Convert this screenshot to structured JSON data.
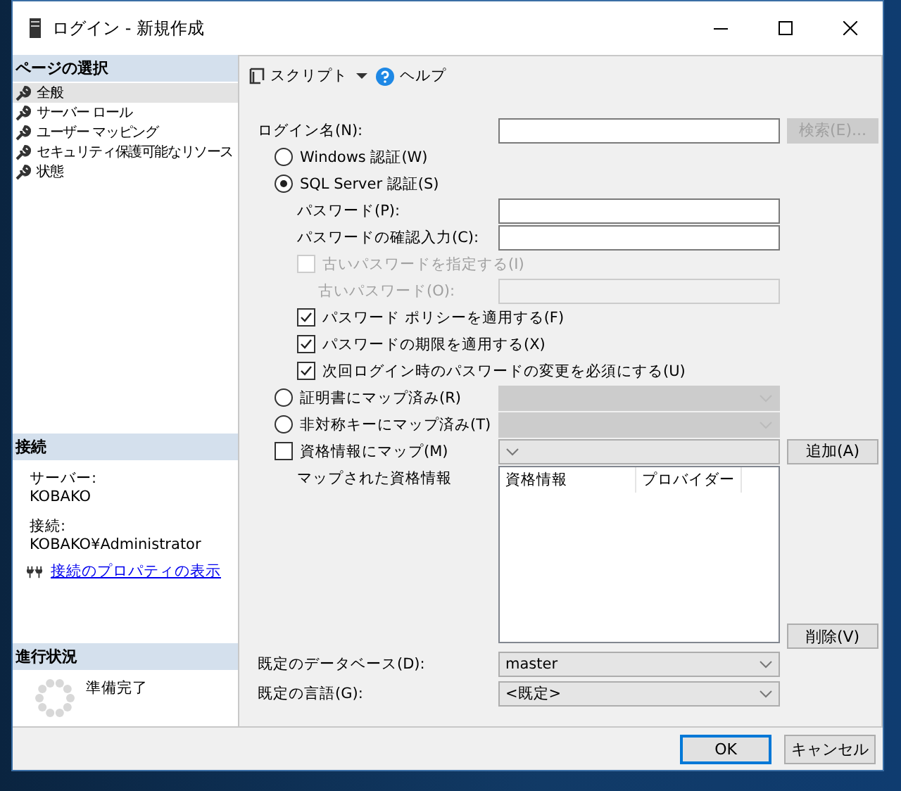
{
  "window": {
    "title": "ログイン - 新規作成"
  },
  "sidebar": {
    "header": "ページの選択",
    "pages": [
      {
        "label": "全般",
        "selected": true
      },
      {
        "label": "サーバー ロール",
        "selected": false
      },
      {
        "label": "ユーザー マッピング",
        "selected": false
      },
      {
        "label": "セキュリティ保護可能なリソース",
        "selected": false
      },
      {
        "label": "状態",
        "selected": false
      }
    ],
    "connection": {
      "header": "接続",
      "server_label": "サーバー:",
      "server": "KOBAKO",
      "connection_label": "接続:",
      "connection": "KOBAKO¥Administrator",
      "link": "接続のプロパティの表示"
    },
    "progress": {
      "header": "進行状況",
      "status": "準備完了"
    }
  },
  "toolbar": [
    {
      "kind": "script",
      "label": "スクリプト"
    },
    {
      "kind": "help",
      "label": "ヘルプ"
    }
  ],
  "rows": [
    {
      "kind": "field",
      "label": "ログイン名(N):",
      "disabled": false,
      "button": {
        "label": "検索(E)...",
        "disabled": true
      }
    },
    {
      "kind": "radio",
      "label": "Windows 認証(W)",
      "selected": false
    },
    {
      "kind": "radio",
      "label": "SQL Server 認証(S)",
      "selected": true,
      "children": [
        {
          "kind": "field",
          "label": "パスワード(P):",
          "disabled": false
        },
        {
          "kind": "field",
          "label": "パスワードの確認入力(C):",
          "disabled": false
        },
        {
          "kind": "checkbox",
          "label": "古いパスワードを指定する(I)",
          "checked": false,
          "disabled": true,
          "children": [
            {
              "kind": "field",
              "label": "古いパスワード(O):",
              "disabled": true
            }
          ]
        },
        {
          "kind": "checkbox",
          "label": "パスワード ポリシーを適用する(F)",
          "checked": true,
          "disabled": false
        },
        {
          "kind": "checkbox",
          "label": "パスワードの期限を適用する(X)",
          "checked": true,
          "disabled": false
        },
        {
          "kind": "checkbox",
          "label": "次回ログイン時のパスワードの変更を必須にする(U)",
          "checked": true,
          "disabled": false
        }
      ]
    },
    {
      "kind": "radio",
      "label": "証明書にマップ済み(R)",
      "selected": false,
      "combo": {
        "disabled": true
      }
    },
    {
      "kind": "radio",
      "label": "非対称キーにマップ済み(T)",
      "selected": false,
      "combo": {
        "disabled": true
      }
    },
    {
      "kind": "checkbox",
      "label": "資格情報にマップ(M)",
      "checked": false,
      "disabled": false,
      "combo": {
        "disabled": false
      },
      "button": {
        "label": "追加(A)",
        "disabled": false
      }
    },
    {
      "kind": "list",
      "label": "マップされた資格情報",
      "columns": [
        "資格情報",
        "プロバイダー"
      ],
      "button": {
        "label": "削除(V)",
        "disabled": false
      }
    },
    {
      "kind": "combo",
      "label": "既定のデータベース(D):",
      "value": "master"
    },
    {
      "kind": "combo",
      "label": "既定の言語(G):",
      "value": "<既定>"
    }
  ],
  "buttons": [
    {
      "label": "OK",
      "default": true
    },
    {
      "label": "キャンセル",
      "default": false
    }
  ]
}
